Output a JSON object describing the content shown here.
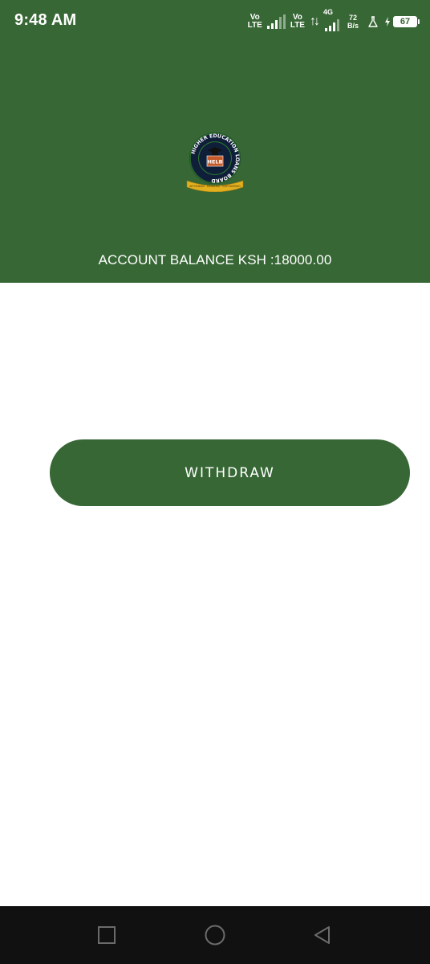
{
  "status_bar": {
    "time": "9:48 AM",
    "sim1": {
      "top": "Vo",
      "bottom": "LTE"
    },
    "sim2": {
      "top": "Vo",
      "bottom": "LTE"
    },
    "network": "4G",
    "speed_value": "72",
    "speed_unit": "B/s",
    "battery_level": "67",
    "icons": [
      "volte-icon",
      "signal-icon",
      "volte-icon",
      "data-transfer-icon",
      "signal-4g-icon",
      "flask-icon",
      "battery-icon"
    ]
  },
  "header": {
    "logo": {
      "ring_text": "HIGHER EDUCATION LOANS BOARD",
      "center_text": "HELB",
      "ribbon_text": "AFFORDING · ENABLING · EMPOWERING"
    },
    "balance_text": "ACCOUNT BALANCE KSH :18000.00"
  },
  "main": {
    "withdraw_label": "WITHDRAW"
  },
  "nav": {
    "icons": [
      "recent-apps-icon",
      "home-icon",
      "back-icon"
    ]
  },
  "colors": {
    "primary": "#376735",
    "background": "#ffffff",
    "navbar": "#111111"
  }
}
